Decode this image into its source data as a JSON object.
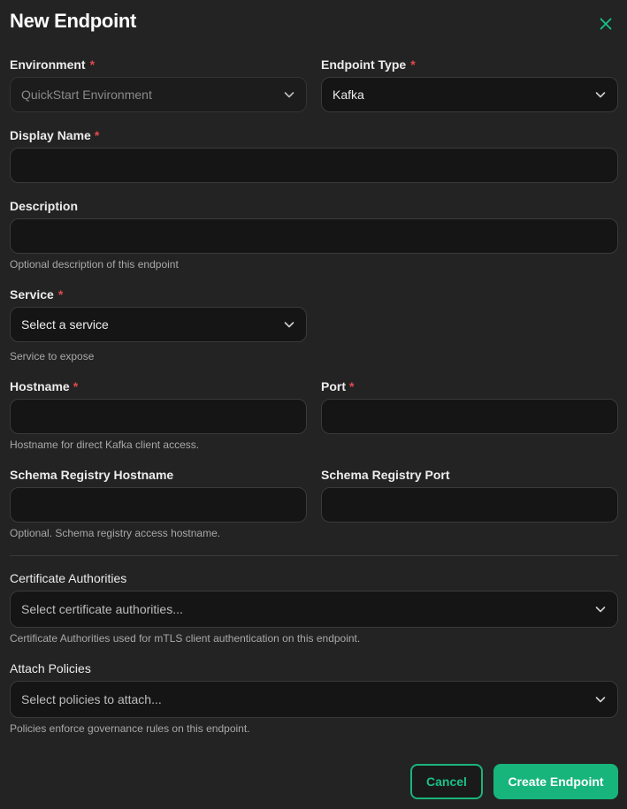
{
  "dialog": {
    "title": "New Endpoint",
    "close_icon": "close-icon"
  },
  "fields": {
    "environment": {
      "label": "Environment",
      "required": "*",
      "value": "QuickStart Environment"
    },
    "endpoint_type": {
      "label": "Endpoint Type",
      "required": "*",
      "value": "Kafka"
    },
    "display_name": {
      "label": "Display Name",
      "required": "*",
      "value": ""
    },
    "description": {
      "label": "Description",
      "value": "",
      "hint": "Optional description of this endpoint"
    },
    "service": {
      "label": "Service",
      "required": "*",
      "placeholder": "Select a service",
      "hint": "Service to expose"
    },
    "hostname": {
      "label": "Hostname",
      "required": "*",
      "value": "",
      "hint": "Hostname for direct Kafka client access."
    },
    "port": {
      "label": "Port",
      "required": "*",
      "value": ""
    },
    "schema_hostname": {
      "label": "Schema Registry Hostname",
      "value": "",
      "hint": "Optional. Schema registry access hostname."
    },
    "schema_port": {
      "label": "Schema Registry Port",
      "value": ""
    },
    "certificate_authorities": {
      "label": "Certificate Authorities",
      "placeholder": "Select certificate authorities...",
      "hint": "Certificate Authorities used for mTLS client authentication on this endpoint."
    },
    "attach_policies": {
      "label": "Attach Policies",
      "placeholder": "Select policies to attach...",
      "hint": "Policies enforce governance rules on this endpoint."
    }
  },
  "actions": {
    "cancel_label": "Cancel",
    "create_label": "Create Endpoint"
  },
  "colors": {
    "background": "#232323",
    "field_background": "#151515",
    "accent": "#17b57c",
    "required": "#e5484d"
  }
}
